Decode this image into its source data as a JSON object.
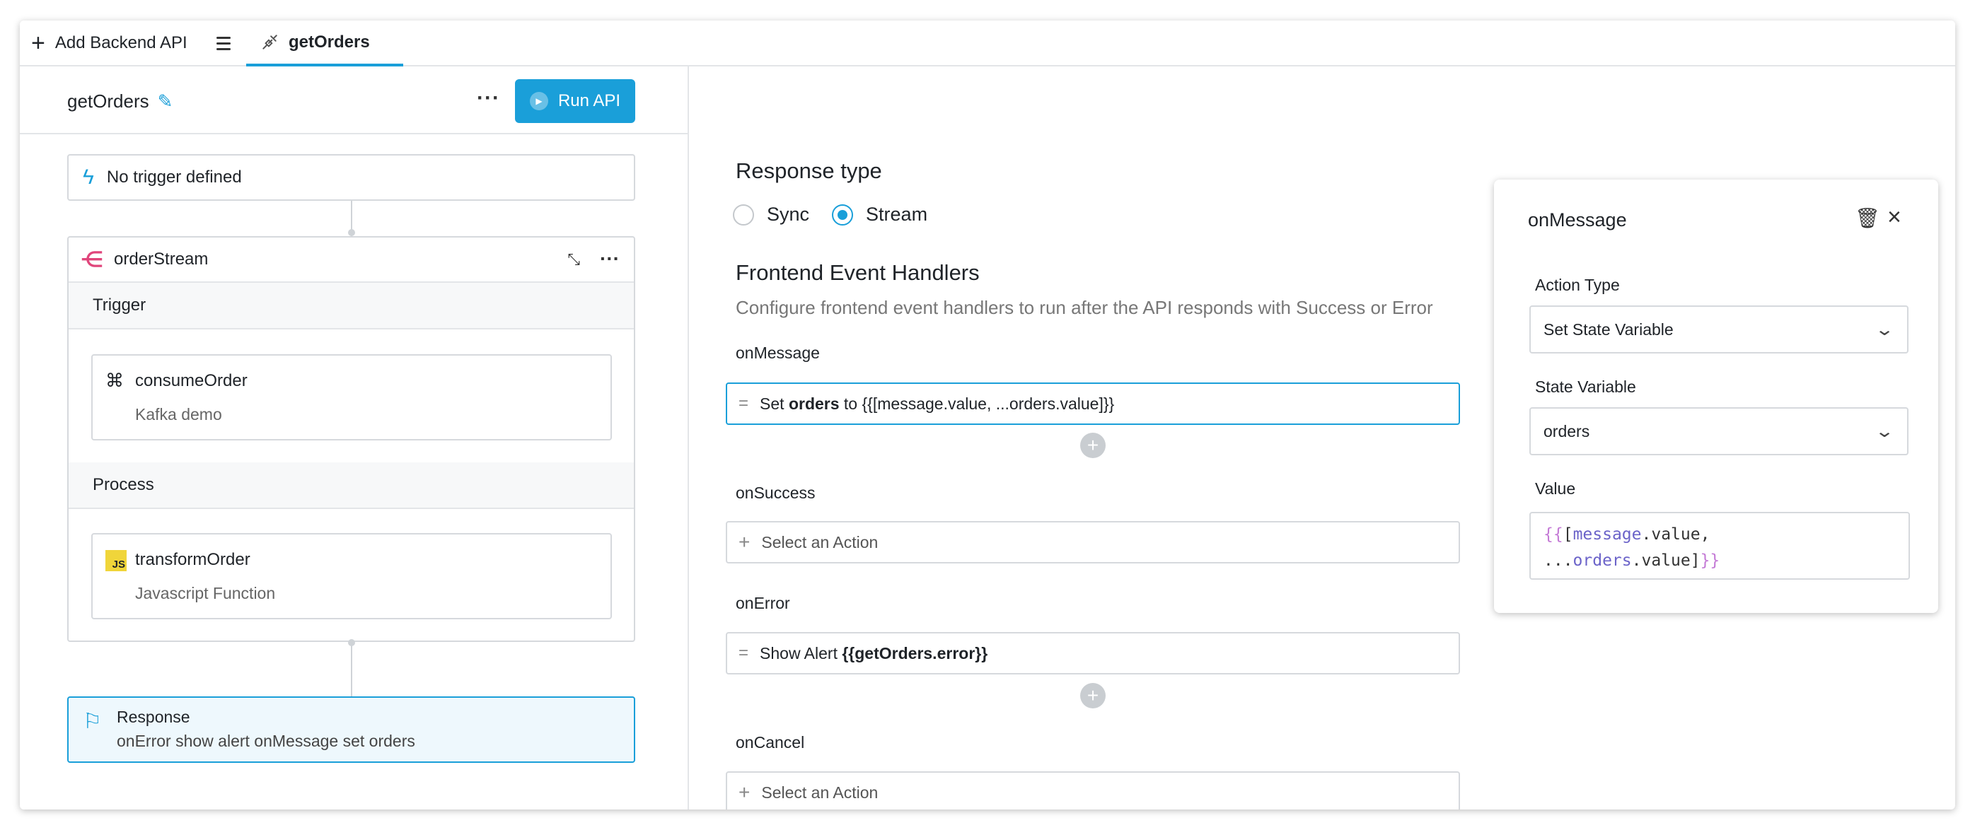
{
  "topbar": {
    "add_api_label": "Add Backend API",
    "tab_label": "getOrders"
  },
  "left": {
    "api_name": "getOrders",
    "run_label": "Run API",
    "trigger_label": "No trigger defined",
    "stream_name": "orderStream",
    "trigger_section": "Trigger",
    "consume_title": "consumeOrder",
    "consume_sub": "Kafka demo",
    "process_section": "Process",
    "transform_title": "transformOrder",
    "transform_sub": "Javascript Function",
    "js_badge": "JS",
    "response_title": "Response",
    "response_sub": "onError show alert onMessage set orders"
  },
  "main": {
    "response_type_title": "Response type",
    "radio_sync": "Sync",
    "radio_stream": "Stream",
    "selected_response_type": "Stream",
    "handlers_title": "Frontend Event Handlers",
    "handlers_desc": "Configure frontend event handlers to run after the API responds with Success or Error",
    "on_message_label": "onMessage",
    "on_message_action_prefix": "Set ",
    "on_message_action_var": "orders",
    "on_message_action_suffix": " to {{[message.value, ...orders.value]}}",
    "on_success_label": "onSuccess",
    "select_action": "Select an Action",
    "on_error_label": "onError",
    "on_error_action_prefix": "Show Alert ",
    "on_error_action_value": "{{getOrders.error}}",
    "on_cancel_label": "onCancel"
  },
  "panel": {
    "title": "onMessage",
    "action_type_label": "Action Type",
    "action_type_value": "Set State Variable",
    "state_variable_label": "State Variable",
    "state_variable_value": "orders",
    "value_label": "Value",
    "code_line1_brace": "{{",
    "code_line1_bracket": "[",
    "code_line1_var": "message",
    "code_line1_rest": ".value,",
    "code_line2_dots": "...",
    "code_line2_var": "orders",
    "code_line2_rest": ".value]",
    "code_line2_brace": "}}"
  },
  "colors": {
    "accent": "#1a9fd9",
    "stream_icon": "#e0457b",
    "js_badge": "#f0d53a"
  }
}
